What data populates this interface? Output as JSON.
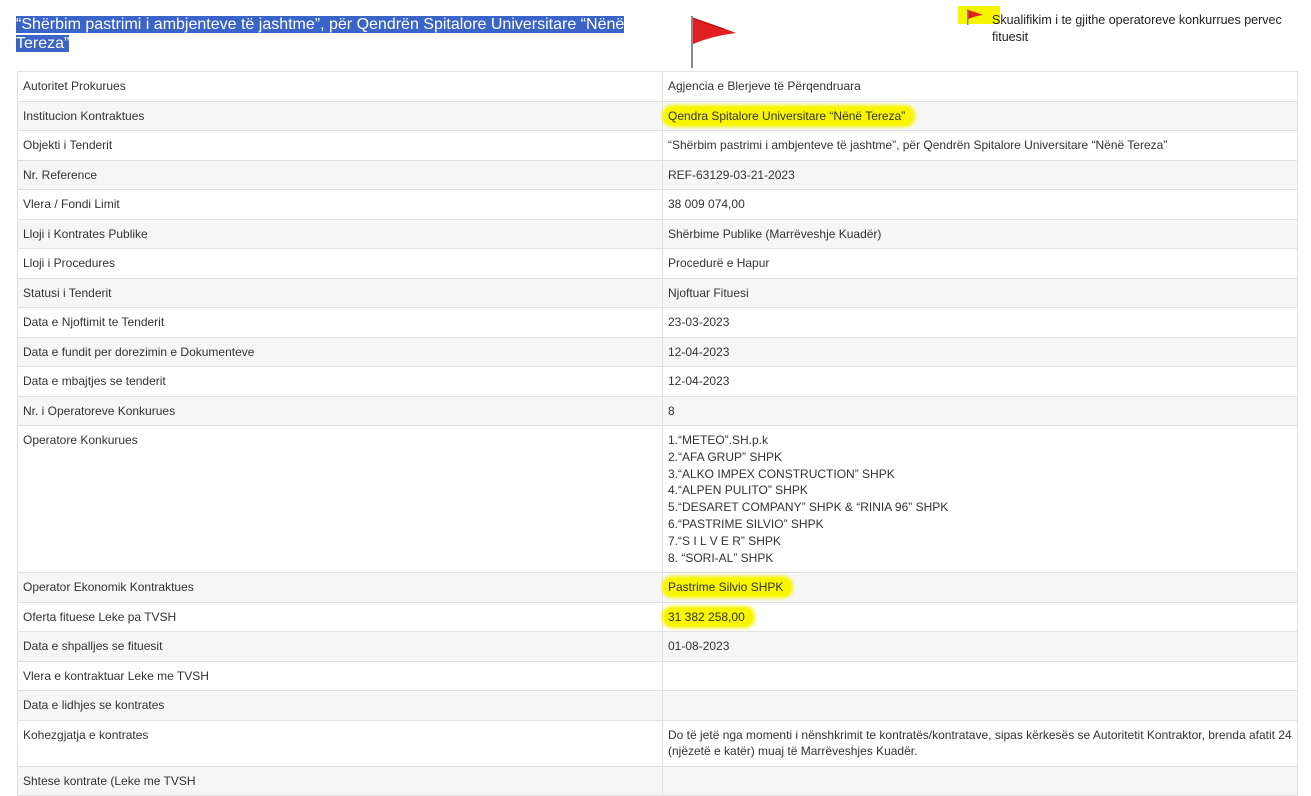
{
  "title": "“Shërbim pastrimi i ambjenteve të jashtme”, për Qendrën Spitalore Universitare “Nënë Tereza”",
  "note": "Skualifikim i te gjithe operatoreve konkurrues pervec fituesit",
  "icons": {
    "flag_big": "red-flag-icon",
    "flag_small": "red-flag-icon"
  },
  "colors": {
    "highlight": "#f8f500",
    "selection": "#3a64c8",
    "flag": "#e02020"
  },
  "rows": [
    {
      "label": "Autoritet Prokurues",
      "value": "Agjencia e Blerjeve të Përqendruara"
    },
    {
      "label": "Institucion Kontraktues",
      "value": "Qendra Spitalore Universitare “Nënë Tereza”"
    },
    {
      "label": "Objekti i Tenderit",
      "value": "“Shërbim pastrimi i ambjenteve të jashtme”, për Qendrën Spitalore Universitare “Nënë Tereza”"
    },
    {
      "label": "Nr. Reference",
      "value": "REF-63129-03-21-2023"
    },
    {
      "label": "Vlera / Fondi Limit",
      "value": "38 009 074,00"
    },
    {
      "label": "Lloji i Kontrates Publike",
      "value": "Shërbime Publike (Marrëveshje Kuadër)"
    },
    {
      "label": "Lloji i Procedures",
      "value": "Procedurë e Hapur"
    },
    {
      "label": "Statusi i Tenderit",
      "value": "Njoftuar Fituesi"
    },
    {
      "label": "Data e Njoftimit te Tenderit",
      "value": "23-03-2023"
    },
    {
      "label": "Data e fundit per dorezimin e Dokumenteve",
      "value": "12-04-2023"
    },
    {
      "label": "Data e mbajtjes se tenderit",
      "value": "12-04-2023"
    },
    {
      "label": "Nr. i Operatoreve Konkurues",
      "value": "8"
    },
    {
      "label": "Operatore Konkurues",
      "values": [
        "1.“METEO”.SH.p.k",
        "2.“AFA GRUP” SHPK",
        "3.“ALKO IMPEX CONSTRUCTION” SHPK",
        "4.“ALPEN PULITO” SHPK",
        "5.“DESARET COMPANY” SHPK & “RINIA 96” SHPK",
        "6.“PASTRIME SILVIO” SHPK",
        "7.“S I L V E R” SHPK",
        "8. “SORI-AL” SHPK"
      ]
    },
    {
      "label": "Operator Ekonomik Kontraktues",
      "value": "Pastrime Silvio SHPK"
    },
    {
      "label": "Oferta fituese Leke pa TVSH",
      "value": "31 382 258,00"
    },
    {
      "label": "Data e shpalljes se fituesit",
      "value": "01-08-2023"
    },
    {
      "label": "Vlera e kontraktuar Leke me TVSH",
      "value": ""
    },
    {
      "label": "Data e lidhjes se kontrates",
      "value": ""
    },
    {
      "label": "Kohezgjatja e kontrates",
      "value": "Do të jetë nga momenti i nënshkrimit te kontratës/kontratave, sipas kërkesës se Autoritetit Kontraktor, brenda afatit 24 (njëzetë e katër) muaj të Marrëveshjes Kuadër."
    },
    {
      "label": "Shtese kontrate (Leke me TVSH",
      "value": ""
    }
  ]
}
